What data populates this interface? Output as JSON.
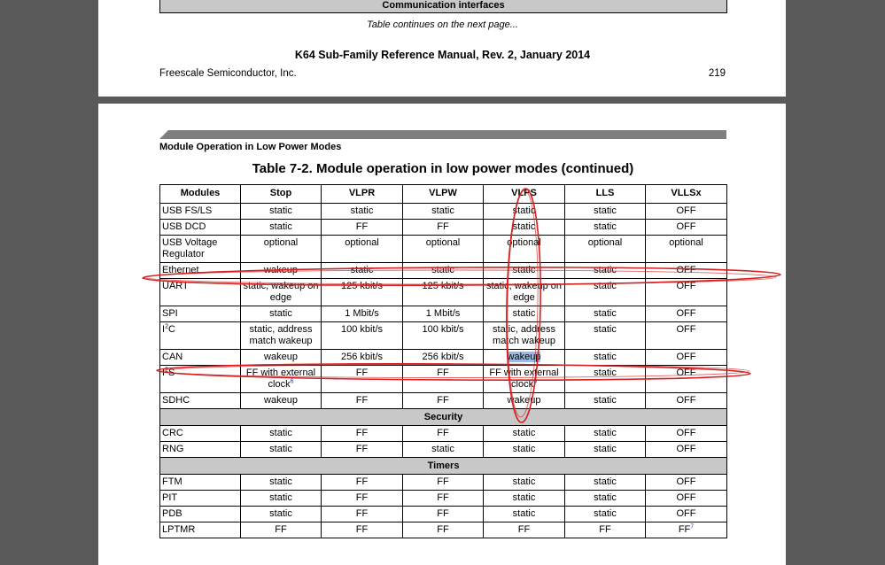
{
  "top_page": {
    "prev_table_last_row": "Communication interfaces",
    "continues_note": "Table continues on the next page...",
    "manual_title": "K64 Sub-Family Reference Manual, Rev. 2, January 2014",
    "publisher": "Freescale Semiconductor, Inc.",
    "page_number": "219"
  },
  "main_page": {
    "section_title": "Module Operation in Low Power Modes",
    "table_caption": "Table 7-2.  Module operation in low power modes (continued)",
    "headers": [
      "Modules",
      "Stop",
      "VLPR",
      "VLPW",
      "VLPS",
      "LLS",
      "VLLSx"
    ],
    "rows": {
      "usb_fsls": [
        "USB FS/LS",
        "static",
        "static",
        "static",
        "static",
        "static",
        "OFF"
      ],
      "usb_dcd": [
        "USB DCD",
        "static",
        "FF",
        "FF",
        "static",
        "static",
        "OFF"
      ],
      "usb_vreg": [
        "USB Voltage Regulator",
        "optional",
        "optional",
        "optional",
        "optional",
        "optional",
        "optional"
      ],
      "ethernet": [
        "Ethernet",
        "wakeup",
        "static",
        "static",
        "static",
        "static",
        "OFF"
      ],
      "uart": [
        "UART",
        "static, wakeup on edge",
        "125 kbit/s",
        "125 kbit/s",
        "static, wakeup on edge",
        "static",
        "OFF"
      ],
      "spi": [
        "SPI",
        "static",
        "1 Mbit/s",
        "1 Mbit/s",
        "static",
        "static",
        "OFF"
      ],
      "i2c": [
        "I",
        "static, address match wakeup",
        "100 kbit/s",
        "100 kbit/s",
        "static, address match wakeup",
        "static",
        "OFF"
      ],
      "can": [
        "CAN",
        "wakeup",
        "256 kbit/s",
        "256 kbit/s",
        "wakeup",
        "static",
        "OFF"
      ],
      "i2s": [
        "I",
        "FF with external clock",
        "FF",
        "FF",
        "FF with external clock",
        "static",
        "OFF"
      ],
      "sdhc": [
        "SDHC",
        "wakeup",
        "FF",
        "FF",
        "wakeup",
        "static",
        "OFF"
      ],
      "crc": [
        "CRC",
        "static",
        "FF",
        "FF",
        "static",
        "static",
        "OFF"
      ],
      "rng": [
        "RNG",
        "static",
        "FF",
        "static",
        "static",
        "static",
        "OFF"
      ],
      "ftm": [
        "FTM",
        "static",
        "FF",
        "FF",
        "static",
        "static",
        "OFF"
      ],
      "pit": [
        "PIT",
        "static",
        "FF",
        "FF",
        "static",
        "static",
        "OFF"
      ],
      "pdb": [
        "PDB",
        "static",
        "FF",
        "FF",
        "static",
        "static",
        "OFF"
      ],
      "lptmr": [
        "LPTMR",
        "FF",
        "FF",
        "FF",
        "FF",
        "FF",
        "FF"
      ]
    },
    "i2c_suffix": "C",
    "i2s_suffix": "S",
    "superscript_two": "2",
    "footnote_six": "6",
    "footnote_seven": "7",
    "section_security": "Security",
    "section_timers": "Timers"
  },
  "colors": {
    "annotation_red": "#d42020",
    "selection_highlight": "#9dbbe0",
    "section_gray": "#c8c8c8"
  }
}
